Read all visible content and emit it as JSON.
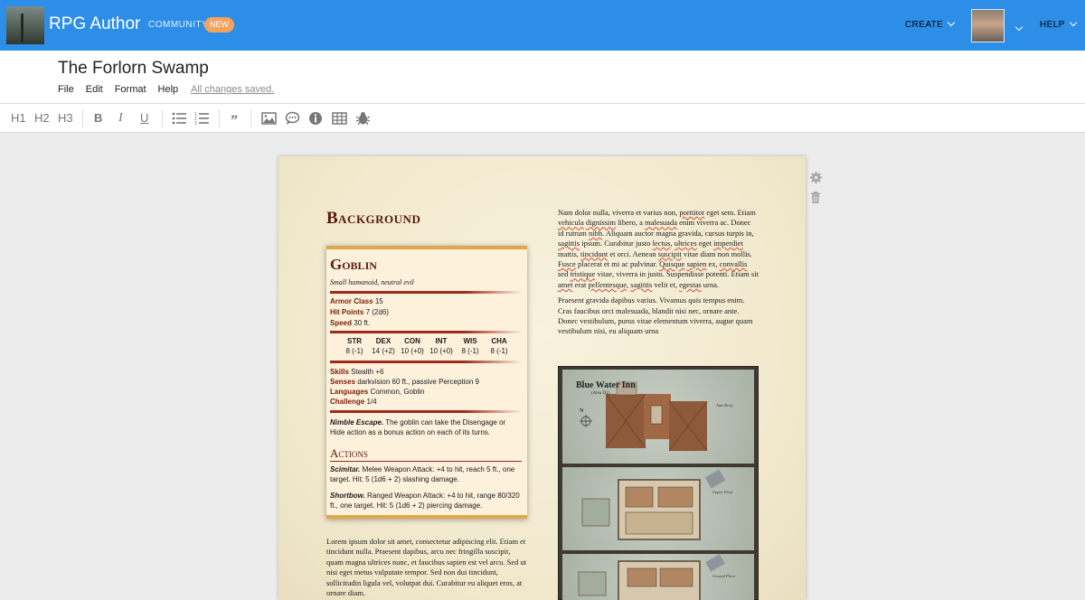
{
  "topbar": {
    "brand": "RPG Author",
    "community": "COMMUNITY",
    "new_badge": "NEW",
    "create": "CREATE",
    "help": "HELP"
  },
  "document": {
    "title": "The Forlorn Swamp",
    "menu": [
      "File",
      "Edit",
      "Format",
      "Help"
    ],
    "save_status": "All changes saved."
  },
  "toolbar": {
    "h1": "H1",
    "h2": "H2",
    "h3": "H3",
    "bold": "B",
    "italic": "I",
    "underline": "U",
    "icons": [
      "bullet-list-icon",
      "numbered-list-icon",
      "quote-icon",
      "image-icon",
      "comment-icon",
      "info-icon",
      "table-icon",
      "bug-icon"
    ]
  },
  "page": {
    "heading": "Background",
    "statblock": {
      "name": "Goblin",
      "subtitle": "Small humanoid, neutral evil",
      "armor_class_label": "Armor Class",
      "armor_class": "15",
      "hit_points_label": "Hit Points",
      "hit_points": "7 (2d6)",
      "speed_label": "Speed",
      "speed": "30 ft.",
      "ability_headers": [
        "STR",
        "DEX",
        "CON",
        "INT",
        "WIS",
        "CHA"
      ],
      "ability_values": [
        "8 (-1)",
        "14 (+2)",
        "10 (+0)",
        "10 (+0)",
        "8 (-1)",
        "8 (-1)"
      ],
      "skills_label": "Skills",
      "skills": "Stealth +6",
      "senses_label": "Senses",
      "senses": "darkvision 60 ft., passive Perception 9",
      "languages_label": "Languages",
      "languages": "Common, Goblin",
      "challenge_label": "Challenge",
      "challenge": "1/4",
      "trait_name": "Nimble Escape.",
      "trait_text": "The goblin can take the Disengage or Hide action as a bonus action on each of its turns.",
      "actions_heading": "Actions",
      "action1_name": "Scimitar.",
      "action1_text": "Melee Weapon Attack: +4 to hit, reach 5 ft., one target. Hit: 5 (1d6 + 2) slashing damage.",
      "action2_name": "Shortbow.",
      "action2_text": "Ranged Weapon Attack: +4 to hit, range 80/320 ft., one target. Hit: 5 (1d6 + 2) piercing damage."
    },
    "left_para": "Lorem ipsum dolor sit amet, consectetur adipiscing elit. Etiam et tincidunt nulla. Praesent dapibus, arcu nec fringilla suscipit, quam magna ultrices nunc, et faucibus sapien est vel arcu. Sed ut nisi eget metus vulputate tempor. Sed non dui tincidunt, sollicitudin ligula vel, volutpat dui. Curabitur eu aliquet eros, at ornare diam.",
    "right_para2": "Praesent gravida dapibus varius. Vivamus quis tempus enim. Cras faucibus orci malesuada, blandit nisi nec, ornare ante. Donec vestibulum, purus vitae elementum viverra, augue quam vestibulum nisi, eu aliquam urna",
    "map": {
      "title": "Blue Water Inn",
      "subtitle": "(Area D1)",
      "label_roof": "Attic/Roof",
      "label_upper": "Upper Floor",
      "label_ground": "Ground Floor",
      "compass": "N"
    }
  },
  "colors": {
    "topbar": "#2d8ee8",
    "badge": "#f5a25d",
    "heading": "#58180d",
    "statblock_border": "#e0a84c"
  }
}
